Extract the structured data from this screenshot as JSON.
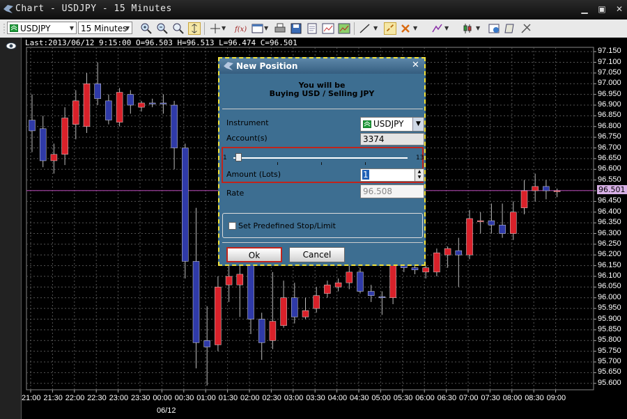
{
  "window": {
    "title": "Chart - USDJPY - 15 Minutes"
  },
  "toolbar": {
    "symbol": "USDJPY",
    "timeframe": "15 Minutes"
  },
  "info_line": "Last:2013/06/12 9:15:00 O=96.503 H=96.513 L=96.474 C=96.501",
  "chart_data": {
    "type": "candlestick",
    "x": [
      "21:00",
      "21:30",
      "22:00",
      "22:30",
      "23:00",
      "23:30",
      "00:00",
      "00:30",
      "01:00",
      "01:30",
      "02:00",
      "02:30",
      "03:00",
      "03:30",
      "04:00",
      "04:30",
      "05:00",
      "05:30",
      "06:00",
      "06:30",
      "07:00",
      "07:30",
      "08:00",
      "08:30",
      "09:00"
    ],
    "date_label": "06/12",
    "y_ticks": [
      "97.150",
      "97.100",
      "97.050",
      "97.000",
      "96.950",
      "96.900",
      "96.850",
      "96.800",
      "96.750",
      "96.700",
      "96.650",
      "96.600",
      "96.550",
      "96.500",
      "96.450",
      "96.400",
      "96.350",
      "96.300",
      "96.250",
      "96.200",
      "96.150",
      "96.100",
      "96.050",
      "96.000",
      "95.950",
      "95.900",
      "95.850",
      "95.800",
      "95.750",
      "95.700",
      "95.650",
      "95.600"
    ],
    "ylim": [
      95.57,
      97.17
    ],
    "last_price": "96.501",
    "colors": {
      "up": "#d9212a",
      "down": "#2f3aa8",
      "current_line": "#9a3e9a",
      "grid": "#555555"
    },
    "candles": [
      {
        "o": 96.83,
        "h": 96.95,
        "l": 96.68,
        "c": 96.78
      },
      {
        "o": 96.79,
        "h": 96.85,
        "l": 96.61,
        "c": 96.64
      },
      {
        "o": 96.64,
        "h": 96.72,
        "l": 96.58,
        "c": 96.67
      },
      {
        "o": 96.67,
        "h": 96.89,
        "l": 96.62,
        "c": 96.84
      },
      {
        "o": 96.81,
        "h": 96.97,
        "l": 96.74,
        "c": 96.92
      },
      {
        "o": 96.8,
        "h": 97.05,
        "l": 96.77,
        "c": 97.0
      },
      {
        "o": 97.0,
        "h": 97.1,
        "l": 96.9,
        "c": 96.93
      },
      {
        "o": 96.92,
        "h": 96.95,
        "l": 96.81,
        "c": 96.83
      },
      {
        "o": 96.82,
        "h": 96.98,
        "l": 96.8,
        "c": 96.96
      },
      {
        "o": 96.95,
        "h": 96.97,
        "l": 96.86,
        "c": 96.9
      },
      {
        "o": 96.89,
        "h": 96.92,
        "l": 96.87,
        "c": 96.91
      },
      {
        "o": 96.91,
        "h": 96.93,
        "l": 96.89,
        "c": 96.905
      },
      {
        "o": 96.91,
        "h": 96.95,
        "l": 96.86,
        "c": 96.905
      },
      {
        "o": 96.9,
        "h": 96.92,
        "l": 96.6,
        "c": 96.7
      },
      {
        "o": 96.7,
        "h": 96.72,
        "l": 96.09,
        "c": 96.17
      },
      {
        "o": 96.17,
        "h": 96.42,
        "l": 95.67,
        "c": 95.79
      },
      {
        "o": 95.8,
        "h": 95.96,
        "l": 95.59,
        "c": 95.77
      },
      {
        "o": 95.78,
        "h": 96.1,
        "l": 95.75,
        "c": 96.05
      },
      {
        "o": 96.06,
        "h": 96.16,
        "l": 95.98,
        "c": 96.1
      },
      {
        "o": 96.06,
        "h": 96.15,
        "l": 95.91,
        "c": 96.11
      },
      {
        "o": 96.17,
        "h": 96.3,
        "l": 95.83,
        "c": 95.9
      },
      {
        "o": 95.9,
        "h": 95.93,
        "l": 95.71,
        "c": 95.79
      },
      {
        "o": 95.8,
        "h": 96.12,
        "l": 95.76,
        "c": 95.89
      },
      {
        "o": 95.87,
        "h": 96.08,
        "l": 95.86,
        "c": 96.0
      },
      {
        "o": 96.0,
        "h": 96.07,
        "l": 95.88,
        "c": 95.91
      },
      {
        "o": 95.91,
        "h": 96.0,
        "l": 95.9,
        "c": 95.94
      },
      {
        "o": 95.95,
        "h": 96.05,
        "l": 95.93,
        "c": 96.01
      },
      {
        "o": 96.02,
        "h": 96.08,
        "l": 96.0,
        "c": 96.06
      },
      {
        "o": 96.05,
        "h": 96.09,
        "l": 96.03,
        "c": 96.07
      },
      {
        "o": 96.07,
        "h": 96.15,
        "l": 96.04,
        "c": 96.12
      },
      {
        "o": 96.12,
        "h": 96.14,
        "l": 96.02,
        "c": 96.03
      },
      {
        "o": 96.03,
        "h": 96.06,
        "l": 95.98,
        "c": 96.01
      },
      {
        "o": 96.005,
        "h": 96.03,
        "l": 95.92,
        "c": 96.0
      },
      {
        "o": 96.0,
        "h": 96.2,
        "l": 95.97,
        "c": 96.16
      },
      {
        "o": 96.16,
        "h": 96.18,
        "l": 96.12,
        "c": 96.14
      },
      {
        "o": 96.14,
        "h": 96.19,
        "l": 96.11,
        "c": 96.13
      },
      {
        "o": 96.12,
        "h": 96.15,
        "l": 96.09,
        "c": 96.14
      },
      {
        "o": 96.12,
        "h": 96.23,
        "l": 96.1,
        "c": 96.21
      },
      {
        "o": 96.2,
        "h": 96.24,
        "l": 96.14,
        "c": 96.23
      },
      {
        "o": 96.22,
        "h": 96.28,
        "l": 96.05,
        "c": 96.2
      },
      {
        "o": 96.2,
        "h": 96.41,
        "l": 96.18,
        "c": 96.37
      },
      {
        "o": 96.36,
        "h": 96.4,
        "l": 96.3,
        "c": 96.36
      },
      {
        "o": 96.36,
        "h": 96.44,
        "l": 96.3,
        "c": 96.34
      },
      {
        "o": 96.34,
        "h": 96.44,
        "l": 96.28,
        "c": 96.3
      },
      {
        "o": 96.3,
        "h": 96.45,
        "l": 96.27,
        "c": 96.4
      },
      {
        "o": 96.42,
        "h": 96.55,
        "l": 96.39,
        "c": 96.5
      },
      {
        "o": 96.5,
        "h": 96.58,
        "l": 96.45,
        "c": 96.52
      },
      {
        "o": 96.52,
        "h": 96.55,
        "l": 96.46,
        "c": 96.5
      },
      {
        "o": 96.5,
        "h": 96.51,
        "l": 96.47,
        "c": 96.5
      }
    ]
  },
  "dialog": {
    "title": "New Position",
    "message_line1": "You will be",
    "message_line2": "Buying USD / Selling JPY",
    "instrument_label": "Instrument",
    "instrument_value": "USDJPY",
    "account_label": "Account(s)",
    "account_value": "3374",
    "slider_min": "1",
    "slider_max": "13",
    "slider_value": 1,
    "amount_label": "Amount (Lots)",
    "amount_value": "1",
    "rate_label": "Rate",
    "rate_value": "96.508",
    "stop_limit_label": "Set Predefined Stop/Limit",
    "ok_label": "Ok",
    "cancel_label": "Cancel"
  }
}
